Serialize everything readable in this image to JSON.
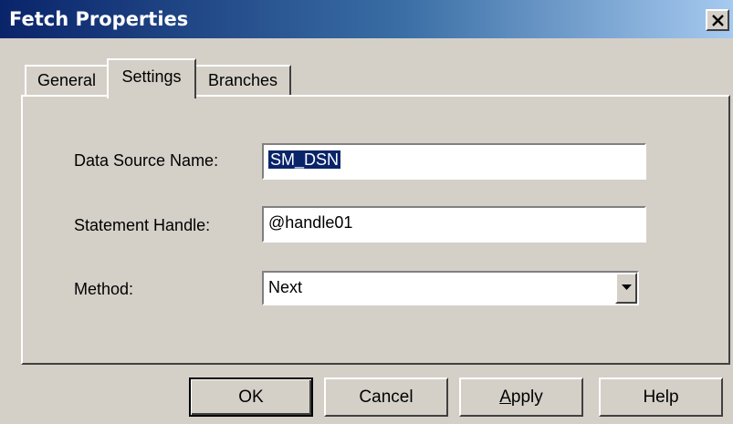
{
  "window": {
    "title": "Fetch Properties",
    "close_icon": "close-icon"
  },
  "tabs": [
    {
      "label": "General",
      "selected": false
    },
    {
      "label": "Settings",
      "selected": true
    },
    {
      "label": "Branches",
      "selected": false
    }
  ],
  "form": {
    "dsn_label": "Data Source Name:",
    "dsn_value": "SM_DSN",
    "statement_label": "Statement Handle:",
    "statement_value": "@handle01",
    "method_label": "Method:",
    "method_value": "Next"
  },
  "buttons": {
    "ok": "OK",
    "cancel": "Cancel",
    "apply": "Apply",
    "help": "Help"
  },
  "colors": {
    "titlebar_start": "#0a246a",
    "titlebar_end": "#a6caf0",
    "dialog_bg": "#d4d0c8",
    "selection_bg": "#0a246a"
  }
}
